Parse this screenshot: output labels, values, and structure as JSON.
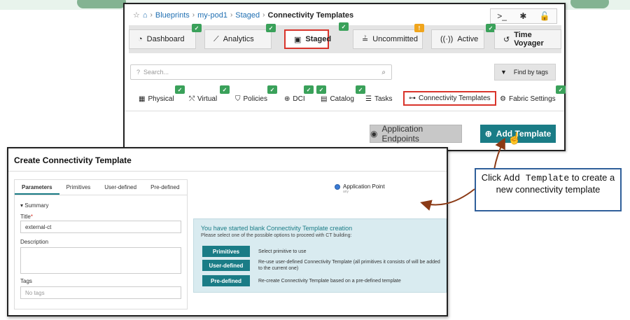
{
  "breadcrumb": {
    "blueprints": "Blueprints",
    "pod": "my-pod1",
    "staged": "Staged",
    "current": "Connectivity Templates"
  },
  "main_tabs": [
    {
      "label": "Dashboard"
    },
    {
      "label": "Analytics"
    },
    {
      "label": "Staged"
    },
    {
      "label": "Uncommitted"
    },
    {
      "label": "Active"
    },
    {
      "label": "Time Voyager"
    }
  ],
  "search": {
    "placeholder": "Search..."
  },
  "find_by_tags": "Find by tags",
  "sub_tabs": [
    {
      "label": "Physical"
    },
    {
      "label": "Virtual"
    },
    {
      "label": "Policies"
    },
    {
      "label": "DCI"
    },
    {
      "label": "Catalog"
    },
    {
      "label": "Tasks"
    },
    {
      "label": "Connectivity Templates"
    },
    {
      "label": "Fabric Settings"
    }
  ],
  "buttons": {
    "app_endpoints": "Application Endpoints",
    "add_template": "Add Template"
  },
  "dialog": {
    "title": "Create Connectivity Template",
    "tabs": [
      "Parameters",
      "Primitives",
      "User-defined",
      "Pre-defined"
    ],
    "summary": "Summary",
    "title_label": "Title",
    "title_value": "external-ct",
    "description_label": "Description",
    "tags_label": "Tags",
    "tags_placeholder": "No tags",
    "app_point": "Application Point",
    "app_point_sub": "any",
    "info_heading": "You have started blank Connectivity Template creation",
    "info_sub": "Please select one of the possible options to proceed with CT building:",
    "options": [
      {
        "button": "Primitives",
        "desc": "Select primitive to use"
      },
      {
        "button": "User-defined",
        "desc": "Re-use user-defined Connectivity Template (all primitives it consists of will be added to the current one)"
      },
      {
        "button": "Pre-defined",
        "desc": "Re-create Connectivity Template based on a pre-defined template"
      }
    ]
  },
  "callout": {
    "pre": "Click ",
    "code": "Add Template",
    "post": " to create a new connectivity template"
  },
  "colors": {
    "accent": "#1a7c86",
    "highlight": "#d9342b",
    "badge": "#3aa15a",
    "warn": "#f0a51c"
  }
}
